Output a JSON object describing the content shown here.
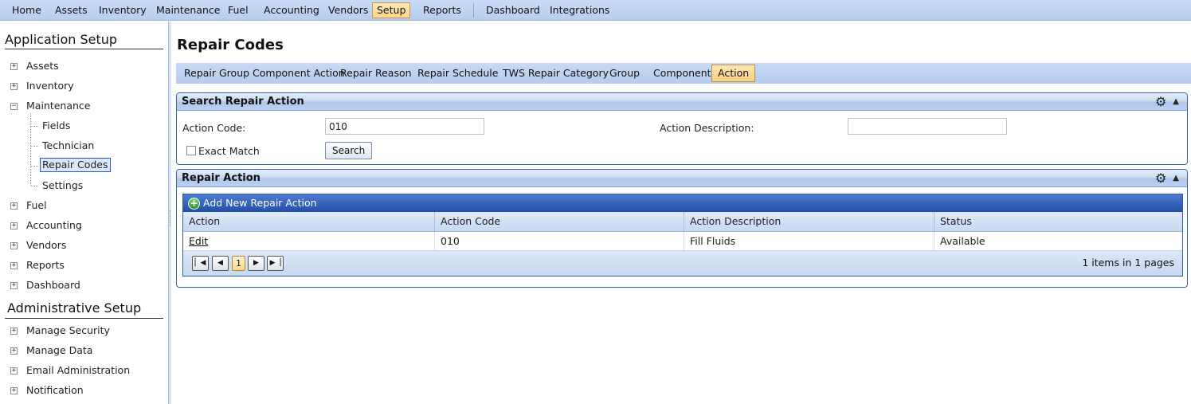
{
  "topmenu": {
    "items": [
      "Home",
      "Assets",
      "Inventory",
      "Maintenance",
      "Fuel",
      "Accounting",
      "Vendors",
      "Setup",
      "Reports"
    ],
    "items_right": [
      "Dashboard",
      "Integrations"
    ],
    "active": "Setup"
  },
  "sidebar": {
    "app_setup_title": "Application Setup",
    "admin_setup_title": "Administrative Setup",
    "app_items": [
      "Assets",
      "Inventory",
      "Maintenance",
      "Fields",
      "Technician",
      "Repair Codes",
      "Settings",
      "Fuel",
      "Accounting",
      "Vendors",
      "Reports",
      "Dashboard"
    ],
    "admin_items": [
      "Manage Security",
      "Manage Data",
      "Email Administration",
      "Notification"
    ],
    "selected": "Repair Codes"
  },
  "page": {
    "title": "Repair Codes"
  },
  "tabs": {
    "items": [
      "Repair Group Component Action",
      "Repair Reason",
      "Repair Schedule",
      "TWS Repair Category",
      "Group",
      "Component",
      "Action"
    ],
    "active": "Action"
  },
  "search_panel": {
    "title": "Search Repair Action",
    "action_code_label": "Action Code:",
    "action_code_value": "010",
    "action_description_label": "Action Description:",
    "action_description_value": "",
    "exact_match_label": "Exact Match",
    "exact_match_checked": false,
    "search_button": "Search"
  },
  "results_panel": {
    "title": "Repair Action",
    "add_new": "Add New Repair Action",
    "columns": [
      "Action",
      "Action Code",
      "Action Description",
      "Status"
    ],
    "rows": [
      {
        "action": "Edit",
        "code": "010",
        "description": "Fill Fluids",
        "status": "Available"
      }
    ],
    "pager": {
      "current_page": "1",
      "info": "1 items in 1 pages"
    }
  },
  "icons": {
    "gear": "gear-icon",
    "collapse": "caret-up-icon",
    "add": "plus-circle-icon"
  },
  "colors": {
    "menu_bar": "#b7cdf0",
    "active_tab": "#fbd48a",
    "panel_border": "#3b64a3",
    "command_bar": "#2350a5"
  }
}
